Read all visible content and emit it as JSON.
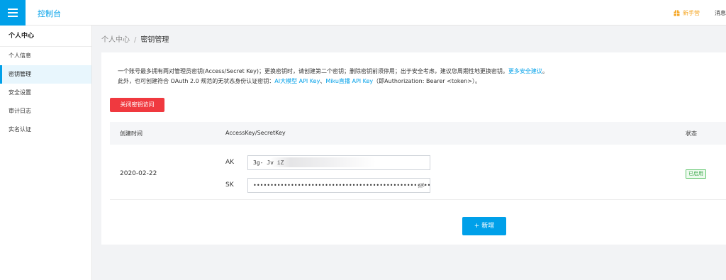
{
  "header": {
    "app_title": "控制台",
    "newbie_label": "新手营",
    "messages_label": "消息"
  },
  "sidebar": {
    "title": "个人中心",
    "items": [
      {
        "label": "个人信息",
        "active": false
      },
      {
        "label": "密钥管理",
        "active": true
      },
      {
        "label": "安全设置",
        "active": false
      },
      {
        "label": "审计日志",
        "active": false
      },
      {
        "label": "实名认证",
        "active": false
      }
    ]
  },
  "breadcrumb": {
    "parent": "个人中心",
    "separator": "/",
    "current": "密钥管理"
  },
  "notice": {
    "line1": "一个账号最多拥有两对管理员密钥(Access/Secret Key)；更换密钥时，请创建第二个密钥；删除密钥前须停用；出于安全考虑，建议您周期性地更换密钥。",
    "line1_link": "更多安全建议",
    "line1_end": "。",
    "line2": "此外，也可创建符合 OAuth 2.0 规范的无状态身份认证密钥：",
    "link_ai": "AI大模型 API Key",
    "sep": "、",
    "link_miku": "Miku直播 API Key",
    "line2_end": "（即Authorization: Bearer <token>）。"
  },
  "actions": {
    "disable_key_access": "关闭密钥访问",
    "add_new": "+ 新增"
  },
  "table": {
    "headers": {
      "created": "创建时间",
      "keys": "AccessKey/SecretKey",
      "status": "状态"
    },
    "rows": [
      {
        "created": "2020-02-22",
        "ak_label": "AK",
        "ak_value": "3g-                                         Jv    iZ",
        "sk_label": "SK",
        "sk_value": "••••••••••••••••••••••••••••••••••••••••••••••••••••••••••••••",
        "status": "已启用"
      }
    ]
  },
  "colors": {
    "accent": "#00a0e9",
    "danger": "#f0393f",
    "success": "#3aa84a",
    "newbie": "#f5a623"
  }
}
